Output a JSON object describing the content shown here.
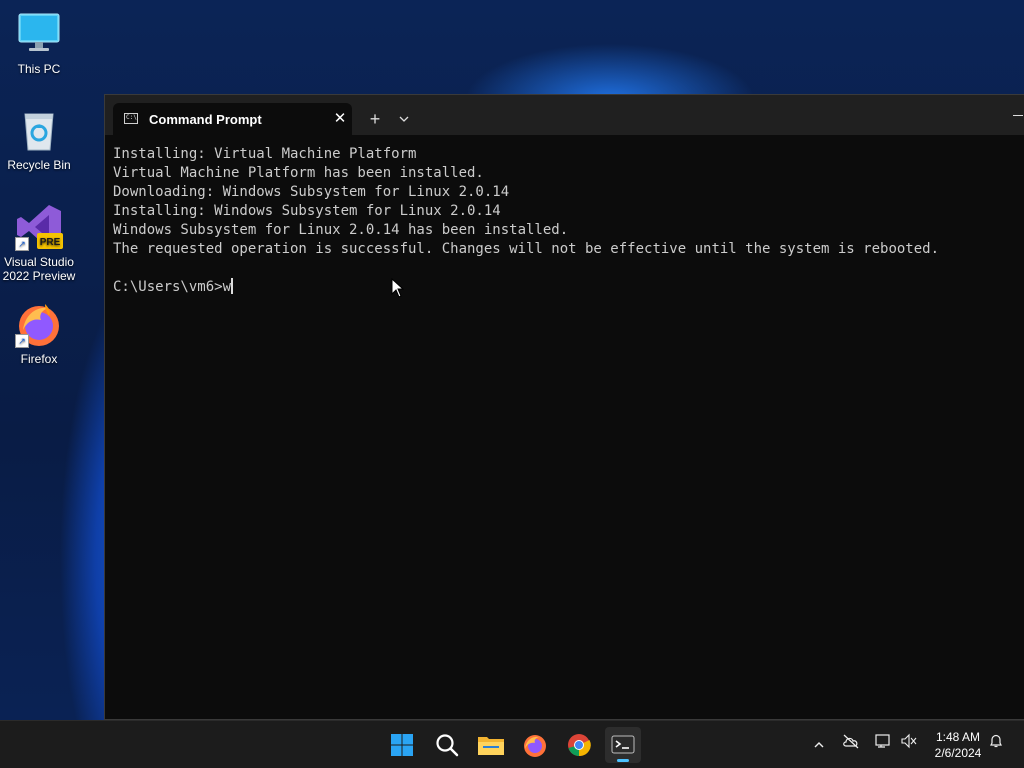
{
  "desktop": {
    "icons": [
      {
        "label": "This PC",
        "icon": "monitor-icon"
      },
      {
        "label": "Recycle Bin",
        "icon": "recycle-bin-icon"
      },
      {
        "label": "Visual Studio\n2022 Preview",
        "icon": "visual-studio-icon",
        "badge": "PRE"
      },
      {
        "label": "Firefox",
        "icon": "firefox-icon"
      }
    ]
  },
  "terminal": {
    "tab_title": "Command Prompt",
    "new_tab": "+",
    "close_glyph": "✕",
    "dropdown_glyph": "⌄",
    "lines": [
      "Installing: Virtual Machine Platform",
      "Virtual Machine Platform has been installed.",
      "Downloading: Windows Subsystem for Linux 2.0.14",
      "Installing: Windows Subsystem for Linux 2.0.14",
      "Windows Subsystem for Linux 2.0.14 has been installed.",
      "The requested operation is successful. Changes will not be effective until the system is rebooted.",
      ""
    ],
    "prompt": "C:\\Users\\vm6>",
    "input": "w"
  },
  "taskbar": {
    "apps": [
      {
        "name": "start",
        "icon": "windows-start-icon"
      },
      {
        "name": "search",
        "icon": "search-icon"
      },
      {
        "name": "file-explorer",
        "icon": "folder-icon"
      },
      {
        "name": "firefox",
        "icon": "firefox-icon"
      },
      {
        "name": "chrome",
        "icon": "chrome-icon"
      },
      {
        "name": "terminal",
        "icon": "terminal-icon",
        "active": true
      }
    ],
    "tray": {
      "chevron": "^",
      "time": "1:48 AM",
      "date": "2/6/2024"
    }
  },
  "colors": {
    "accent": "#4cc2ff",
    "console_bg": "#0c0c0c",
    "console_fg": "#cccccc",
    "titlebar": "#202020",
    "taskbar": "#1c1c1c"
  }
}
